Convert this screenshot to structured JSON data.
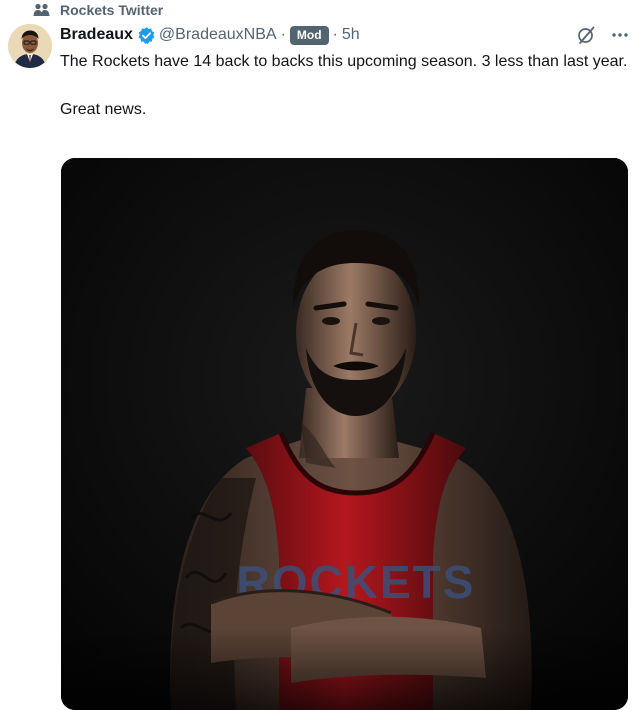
{
  "community": {
    "name": "Rockets Twitter",
    "icon": "community-people-icon"
  },
  "author": {
    "display_name": "Bradeaux",
    "handle": "@BradeauxNBA",
    "verified": true,
    "badge": "Mod",
    "timestamp": "5h"
  },
  "header_separator": "·",
  "tweet": {
    "text": "The Rockets have 14 back to backs this upcoming season. 3 less than last year.\n\nGreat news."
  },
  "icons": [
    "verified-badge-icon",
    "grok-icon",
    "more-options-icon"
  ],
  "media": {
    "type": "photo",
    "jersey_text": "ROCKETS"
  },
  "colors": {
    "accent": "#1d9bf0",
    "secondary_text": "#536471",
    "jersey_red": "#b5171e"
  }
}
